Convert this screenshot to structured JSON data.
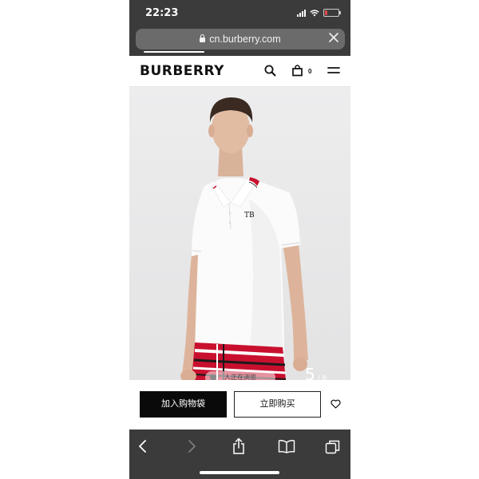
{
  "status_bar": {
    "time": "22:23",
    "battery_percent": 20
  },
  "browser": {
    "url": "cn.burberry.com",
    "load_progress": 0.29,
    "icons": [
      "lock-icon",
      "close-icon"
    ]
  },
  "site": {
    "logo": "BURBERRY",
    "cart_count": "0",
    "icons": [
      "search-icon",
      "bag-icon",
      "menu-icon"
    ]
  },
  "product": {
    "viewing_badge": "人正在浏览",
    "image_index": "5",
    "image_total": "/ 6"
  },
  "actions": {
    "add_to_bag": "加入购物袋",
    "buy_now": "立即购买",
    "wishlist_icon": "heart-icon"
  },
  "toolbar": {
    "icons": [
      "back-icon",
      "forward-icon",
      "share-icon",
      "bookmarks-icon",
      "tabs-icon"
    ]
  },
  "colors": {
    "browser_chrome": "#3b3b3b",
    "url_field": "#6b6b6b",
    "primary_button": "#0a0a0a",
    "accent_red": "#c8102e"
  }
}
